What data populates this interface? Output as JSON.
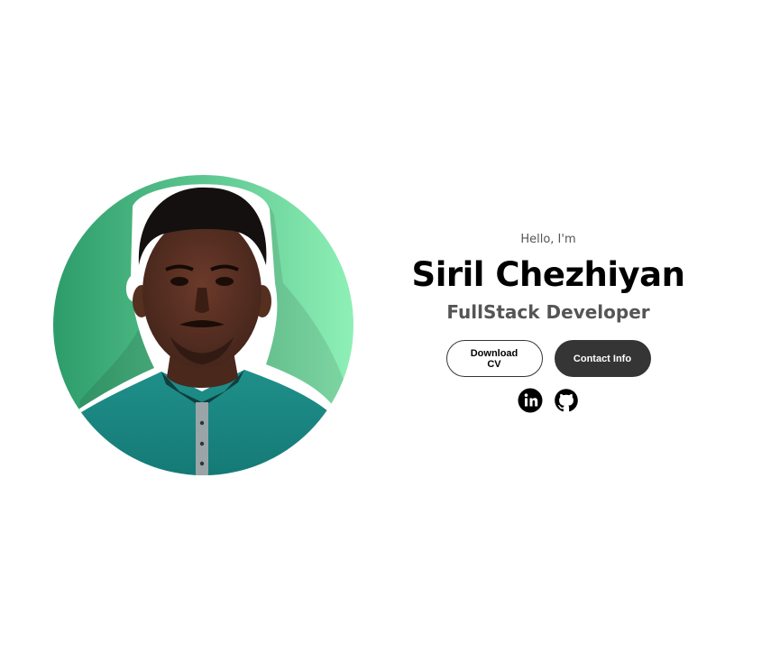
{
  "hero": {
    "greeting": "Hello, I'm",
    "name": "Siril Chezhiyan",
    "role": "FullStack Developer"
  },
  "buttons": {
    "download_cv": "Download CV",
    "contact_info": "Contact Info"
  },
  "socials": [
    {
      "icon": "linkedin-icon"
    },
    {
      "icon": "github-icon"
    }
  ],
  "colors": {
    "background": "#ffffff",
    "dark_button": "#353535",
    "subtitle": "#555555",
    "avatar_gradient_start": "#2c9c6a",
    "avatar_gradient_end": "#8ef0b6"
  }
}
